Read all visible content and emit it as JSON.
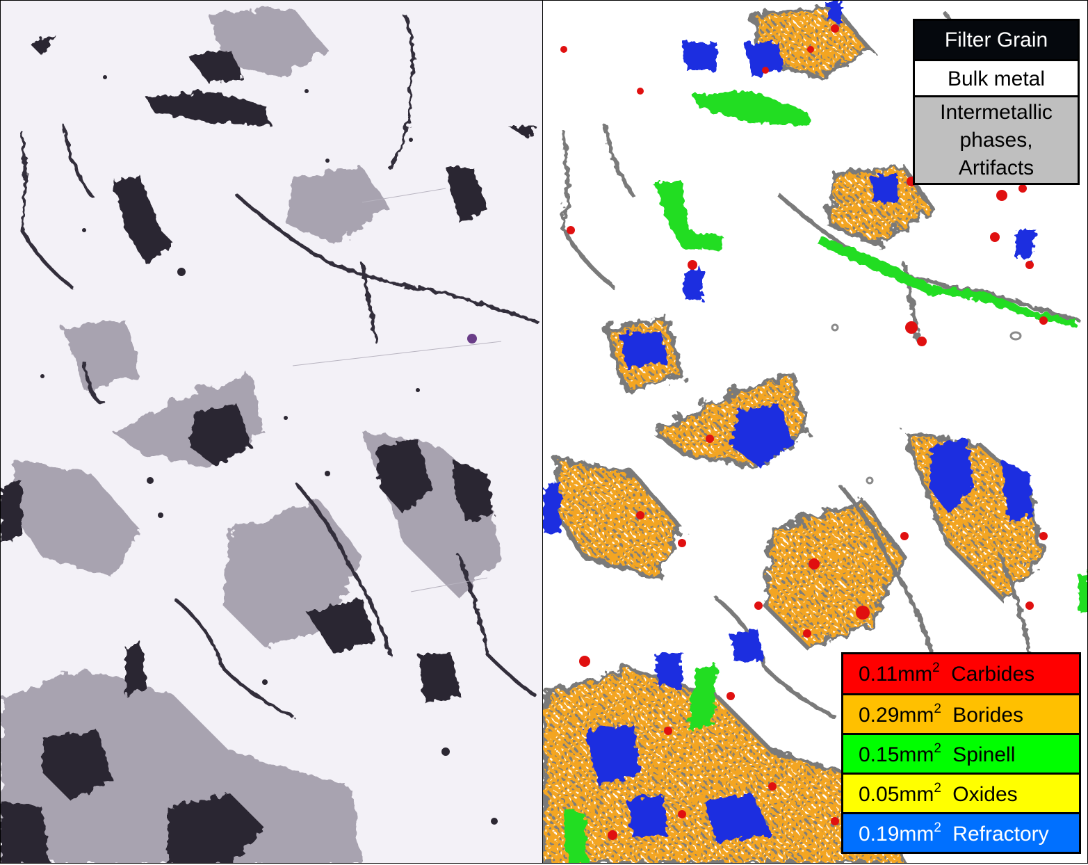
{
  "panels": {
    "left": {
      "description_icon": "micrograph-icon"
    },
    "right": {
      "description_icon": "phase-map-icon"
    }
  },
  "top_legend": {
    "filter_grain": "Filter Grain",
    "bulk_metal": "Bulk metal",
    "intermetallic": [
      "Intermetallic",
      "phases,",
      "Artifacts"
    ],
    "colors": {
      "filter_grain": "#05080d",
      "bulk_metal": "#ffffff",
      "intermetallic": "#bfbfbf"
    }
  },
  "phases": [
    {
      "area_value": "0.11mm",
      "exponent": "2",
      "name": "Carbides",
      "color": "#ff0000",
      "text_color": "#000000"
    },
    {
      "area_value": "0.29mm",
      "exponent": "2",
      "name": "Borides",
      "color": "#ffc000",
      "text_color": "#000000"
    },
    {
      "area_value": "0.15mm",
      "exponent": "2",
      "name": "Spinell",
      "color": "#00ff00",
      "text_color": "#000000"
    },
    {
      "area_value": "0.05mm",
      "exponent": "2",
      "name": "Oxides",
      "color": "#ffff00",
      "text_color": "#000000"
    },
    {
      "area_value": "0.19mm",
      "exponent": "2",
      "name": "Refractory",
      "color": "#0070ff",
      "text_color": "#ffffff"
    }
  ],
  "map_colors": {
    "carbides": "#e01010",
    "borides": "#f0a020",
    "spinell": "#22dd22",
    "oxides": "#ffee00",
    "refractory": "#1f2fe0",
    "intermetallic": "#7a7a7a",
    "filter_grain": "#1a1a22",
    "micrograph_dark": "#2a2630",
    "micrograph_mid": "#8a8494"
  }
}
